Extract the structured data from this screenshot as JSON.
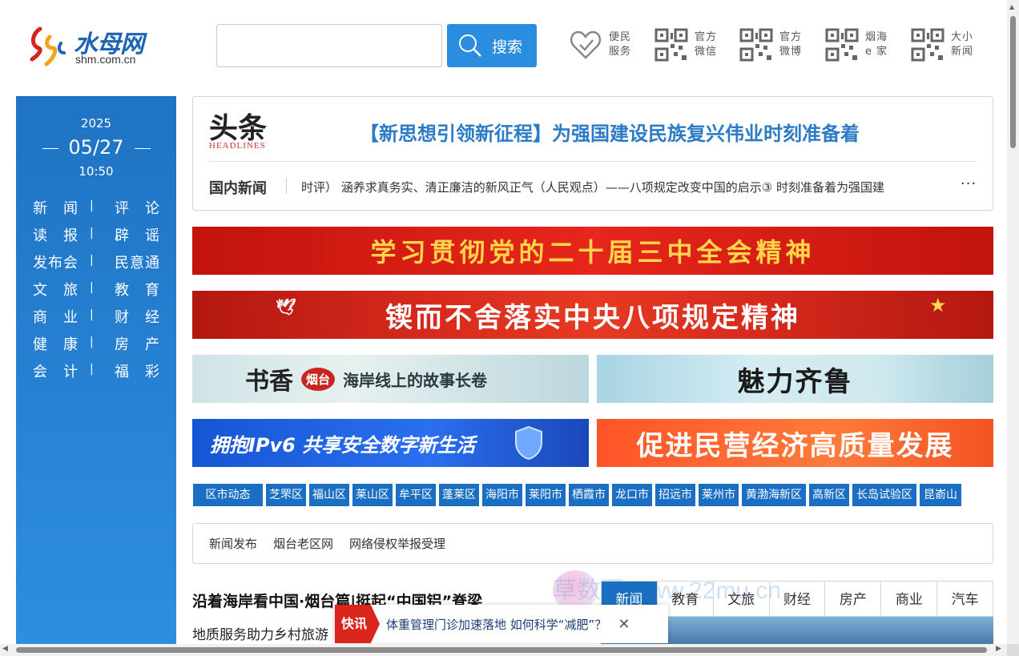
{
  "header": {
    "logo_cn": "水母网",
    "logo_en": "shm.com.cn",
    "search_placeholder": "",
    "search_label": "搜索",
    "tools": [
      {
        "icon": "heart-icon",
        "line1": "便民",
        "line2": "服务"
      },
      {
        "icon": "qr-code-icon",
        "line1": "官方",
        "line2": "微信"
      },
      {
        "icon": "qr-code-icon",
        "line1": "官方",
        "line2": "微博"
      },
      {
        "icon": "qr-code-icon",
        "line1": "烟海",
        "line2": "e 家"
      },
      {
        "icon": "qr-code-icon",
        "line1": "大小",
        "line2": "新闻"
      }
    ]
  },
  "sidebar": {
    "year": "2025",
    "date": "05/27",
    "time": "10:50",
    "sep": "|",
    "nav": [
      {
        "left": "新闻",
        "right": "评论"
      },
      {
        "left": "读报",
        "right": "辟谣"
      },
      {
        "left": "发布会",
        "right": "民意通"
      },
      {
        "left": "文旅",
        "right": "教育"
      },
      {
        "left": "商业",
        "right": "财经"
      },
      {
        "left": "健康",
        "right": "房产"
      },
      {
        "left": "会计",
        "right": "福彩"
      }
    ]
  },
  "headlines": {
    "logo_cn": "头条",
    "logo_en": "HEADLINES",
    "title": "【新思想引领新征程】为强国建设民族复兴伟业时刻准备着",
    "domestic_label": "国内新闻",
    "ticker": "时评）    涵养求真务实、清正廉洁的新风正气（人民观点）——八项规定改变中国的启示③    时刻准备着为强国建",
    "more": "···"
  },
  "banners": {
    "b1": "学习贯彻党的二十届三中全会精神",
    "b2": "锲而不舍落实中央八项规定精神",
    "b3_big": "书香",
    "b3_seal": "烟台",
    "b3_text": "海岸线上的故事长卷",
    "b4": "魅力齐鲁",
    "b5": "拥抱IPv6 共享安全数字新生活",
    "b6": "促进民营经济高质量发展"
  },
  "districts": [
    "区市动态",
    "芝罘区",
    "福山区",
    "莱山区",
    "牟平区",
    "蓬莱区",
    "海阳市",
    "莱阳市",
    "栖霞市",
    "龙口市",
    "招远市",
    "莱州市",
    "黄渤海新区",
    "高新区",
    "长岛试验区",
    "昆嵛山"
  ],
  "links": [
    "新闻发布",
    "烟台老区网",
    "网络侵权举报受理"
  ],
  "news": {
    "headline": "沿着海岸看中国·烟台篇|挺起“中国铝”脊梁",
    "sub": "地质服务助力乡村旅游"
  },
  "tabs": [
    "新闻",
    "教育",
    "文旅",
    "财经",
    "房产",
    "商业",
    "汽车"
  ],
  "active_tab": "新闻",
  "watermark": "草数网 www.22mu.cn",
  "flash": {
    "tag": "快讯",
    "text": "体重管理门诊加速落地 如何科学“减肥”？",
    "close": "✕"
  },
  "colors": {
    "accent_blue": "#1b6fc3",
    "headline_blue": "#2b7bc6",
    "banner_red": "#d72a1c",
    "flash_red": "#d9251c"
  }
}
